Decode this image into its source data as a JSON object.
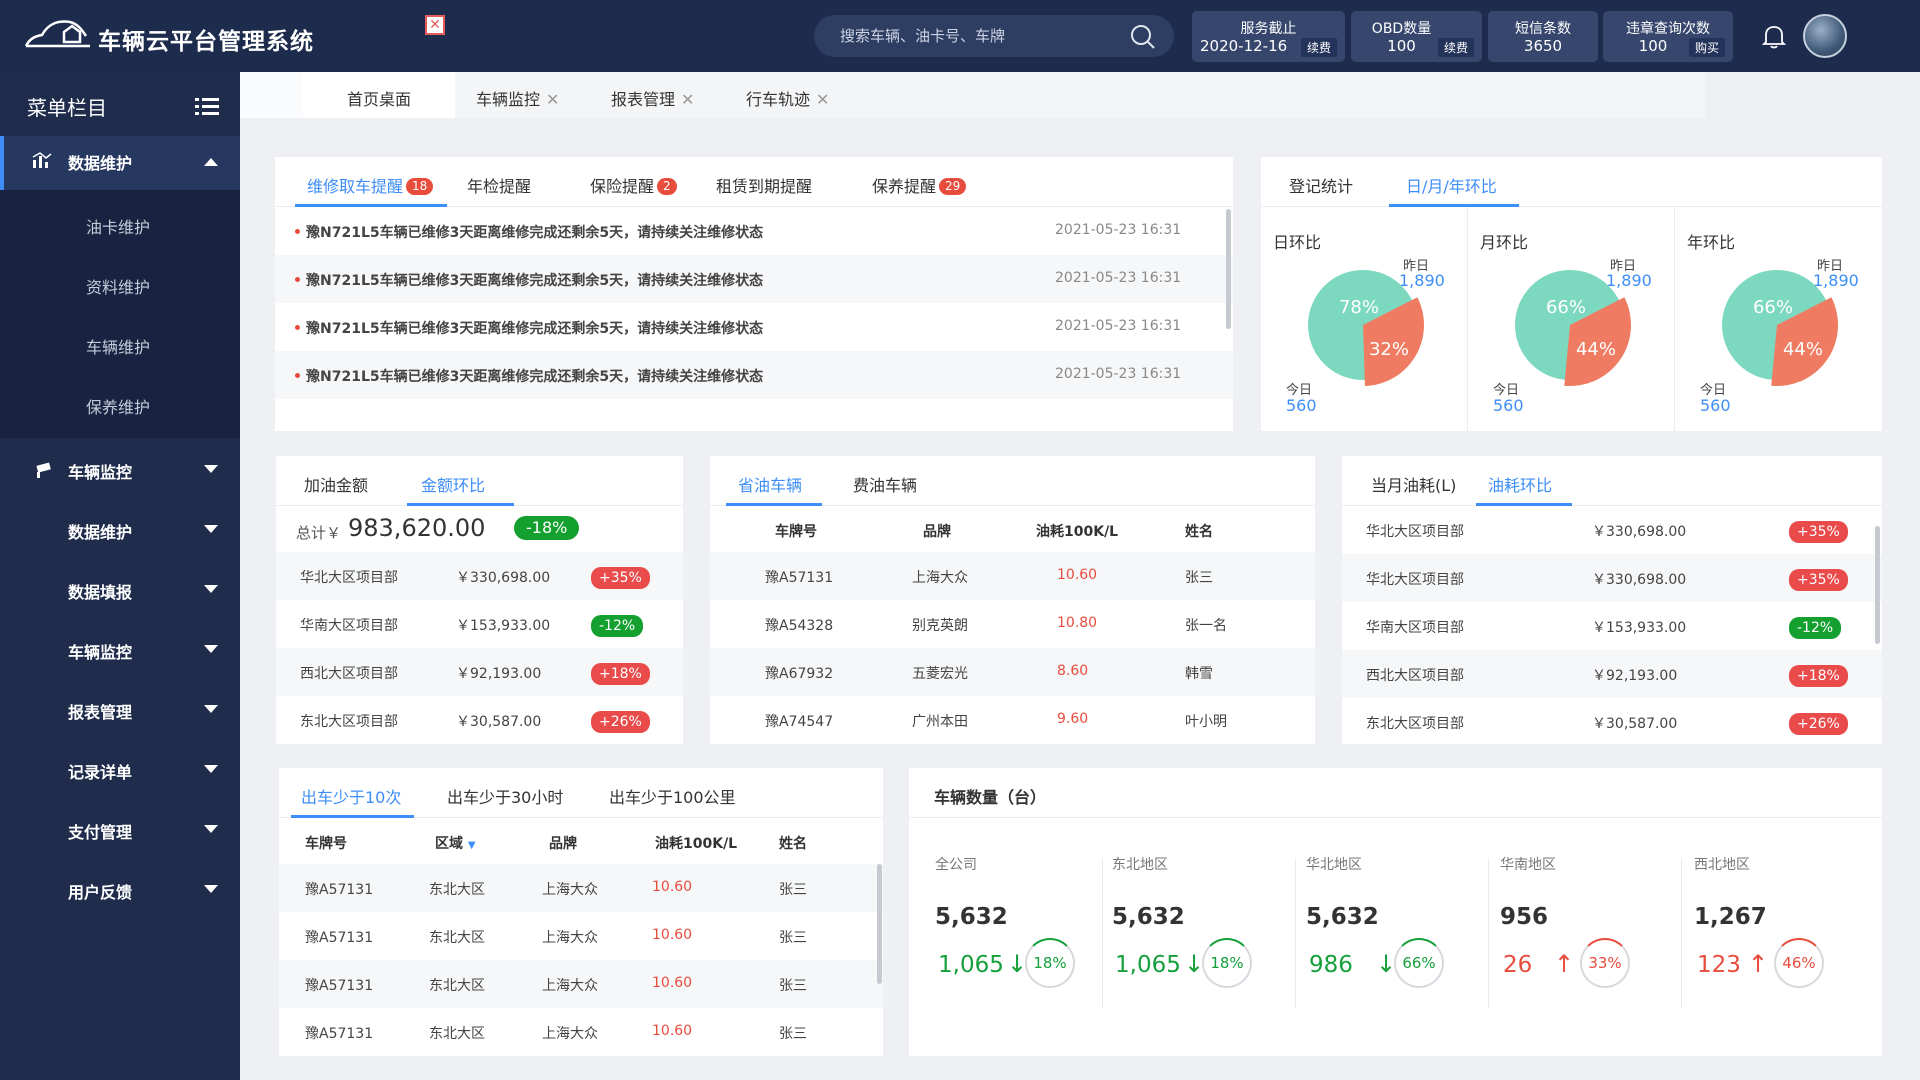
{
  "header": {
    "app_title": "车辆云平台管理系统",
    "search_placeholder": "搜索车辆、油卡号、车牌",
    "cards": [
      {
        "title": "服务截止",
        "value": "2020-12-16",
        "tag": "续费"
      },
      {
        "title": "OBD数量",
        "value": "100",
        "tag": "续费"
      },
      {
        "title": "短信条数",
        "value": "3650",
        "tag": ""
      },
      {
        "title": "违章查询次数",
        "value": "100",
        "tag": "购买"
      }
    ]
  },
  "sidebar": {
    "title": "菜单栏目",
    "active": {
      "label": "数据维护",
      "subitems": [
        "油卡维护",
        "资料维护",
        "车辆维护",
        "保养维护"
      ]
    },
    "items": [
      "车辆监控",
      "数据维护",
      "数据填报",
      "车辆监控",
      "报表管理",
      "记录详单",
      "支付管理",
      "用户反馈"
    ]
  },
  "page_tabs": [
    "首页桌面",
    "车辆监控",
    "报表管理",
    "行车轨迹"
  ],
  "reminders": {
    "tabs": [
      {
        "label": "维修取车提醒",
        "badge": "18"
      },
      {
        "label": "年检提醒",
        "badge": ""
      },
      {
        "label": "保险提醒",
        "badge": "2"
      },
      {
        "label": "租赁到期提醒",
        "badge": ""
      },
      {
        "label": "保养提醒",
        "badge": "29"
      }
    ],
    "rows": [
      {
        "text": "豫N721L5车辆已维修3天距离维修完成还剩余5天，请持续关注维修状态",
        "time": "2021-05-23 16:31"
      },
      {
        "text": "豫N721L5车辆已维修3天距离维修完成还剩余5天，请持续关注维修状态",
        "time": "2021-05-23 16:31"
      },
      {
        "text": "豫N721L5车辆已维修3天距离维修完成还剩余5天，请持续关注维修状态",
        "time": "2021-05-23 16:31"
      },
      {
        "text": "豫N721L5车辆已维修3天距离维修完成还剩余5天，请持续关注维修状态",
        "time": "2021-05-23 16:31"
      }
    ]
  },
  "ratio": {
    "tabs": [
      "登记统计",
      "日/月/年环比"
    ],
    "prev_label": "昨日",
    "today_label": "今日",
    "charts": [
      {
        "title": "日环比",
        "prev": "1,890",
        "today": "560",
        "big": "78%",
        "small": "32%",
        "big_pct": 68
      },
      {
        "title": "月环比",
        "prev": "1,890",
        "today": "560",
        "big": "66%",
        "small": "44%",
        "big_pct": 66
      },
      {
        "title": "年环比",
        "prev": "1,890",
        "today": "560",
        "big": "66%",
        "small": "44%",
        "big_pct": 66
      }
    ],
    "colors": {
      "big": "#7dd8c0",
      "small": "#ef7c62"
    }
  },
  "fuel_amount": {
    "tabs": [
      "加油金额",
      "金额环比"
    ],
    "total_label": "总计￥",
    "total": "983,620.00",
    "total_change": "-18%",
    "rows": [
      {
        "name": "华北大区项目部",
        "amount": "￥330,698.00",
        "change": "+35%",
        "dir": "r"
      },
      {
        "name": "华南大区项目部",
        "amount": "￥153,933.00",
        "change": "-12%",
        "dir": "g"
      },
      {
        "name": "西北大区项目部",
        "amount": "￥92,193.00",
        "change": "+18%",
        "dir": "r"
      },
      {
        "name": "东北大区项目部",
        "amount": "￥30,587.00",
        "change": "+26%",
        "dir": "r"
      }
    ]
  },
  "save_fuel": {
    "tabs": [
      "省油车辆",
      "费油车辆"
    ],
    "headers": [
      "车牌号",
      "品牌",
      "油耗100K/L",
      "姓名"
    ],
    "rows": [
      [
        "豫A57131",
        "上海大众",
        "10.60",
        "张三"
      ],
      [
        "豫A54328",
        "别克英朗",
        "10.80",
        "张一名"
      ],
      [
        "豫A67932",
        "五菱宏光",
        "8.60",
        "韩雪"
      ],
      [
        "豫A74547",
        "广州本田",
        "9.60",
        "叶小明"
      ]
    ]
  },
  "consumption": {
    "tabs": [
      "当月油耗(L)",
      "油耗环比"
    ],
    "rows": [
      {
        "name": "华北大区项目部",
        "amount": "￥330,698.00",
        "change": "+35%",
        "dir": "r"
      },
      {
        "name": "华北大区项目部",
        "amount": "￥330,698.00",
        "change": "+35%",
        "dir": "r"
      },
      {
        "name": "华南大区项目部",
        "amount": "￥153,933.00",
        "change": "-12%",
        "dir": "g"
      },
      {
        "name": "西北大区项目部",
        "amount": "￥92,193.00",
        "change": "+18%",
        "dir": "r"
      },
      {
        "name": "东北大区项目部",
        "amount": "￥30,587.00",
        "change": "+26%",
        "dir": "r"
      }
    ]
  },
  "trips": {
    "tabs": [
      "出车少于10次",
      "出车少于30小时",
      "出车少于100公里"
    ],
    "headers": [
      "车牌号",
      "区域",
      "品牌",
      "油耗100K/L",
      "姓名"
    ],
    "rows": [
      [
        "豫A57131",
        "东北大区",
        "上海大众",
        "10.60",
        "张三"
      ],
      [
        "豫A57131",
        "东北大区",
        "上海大众",
        "10.60",
        "张三"
      ],
      [
        "豫A57131",
        "东北大区",
        "上海大众",
        "10.60",
        "张三"
      ],
      [
        "豫A57131",
        "东北大区",
        "上海大众",
        "10.60",
        "张三"
      ]
    ]
  },
  "vehicles": {
    "title": "车辆数量（台）",
    "regions": [
      {
        "name": "全公司",
        "total": "5,632",
        "sub": "1,065",
        "pct": "18%",
        "trend": "down"
      },
      {
        "name": "东北地区",
        "total": "5,632",
        "sub": "1,065",
        "pct": "18%",
        "trend": "down"
      },
      {
        "name": "华北地区",
        "total": "5,632",
        "sub": "986",
        "pct": "66%",
        "trend": "down"
      },
      {
        "name": "华南地区",
        "total": "956",
        "sub": "26",
        "pct": "33%",
        "trend": "up"
      },
      {
        "name": "西北地区",
        "total": "1,267",
        "sub": "123",
        "pct": "46%",
        "trend": "up"
      }
    ]
  }
}
